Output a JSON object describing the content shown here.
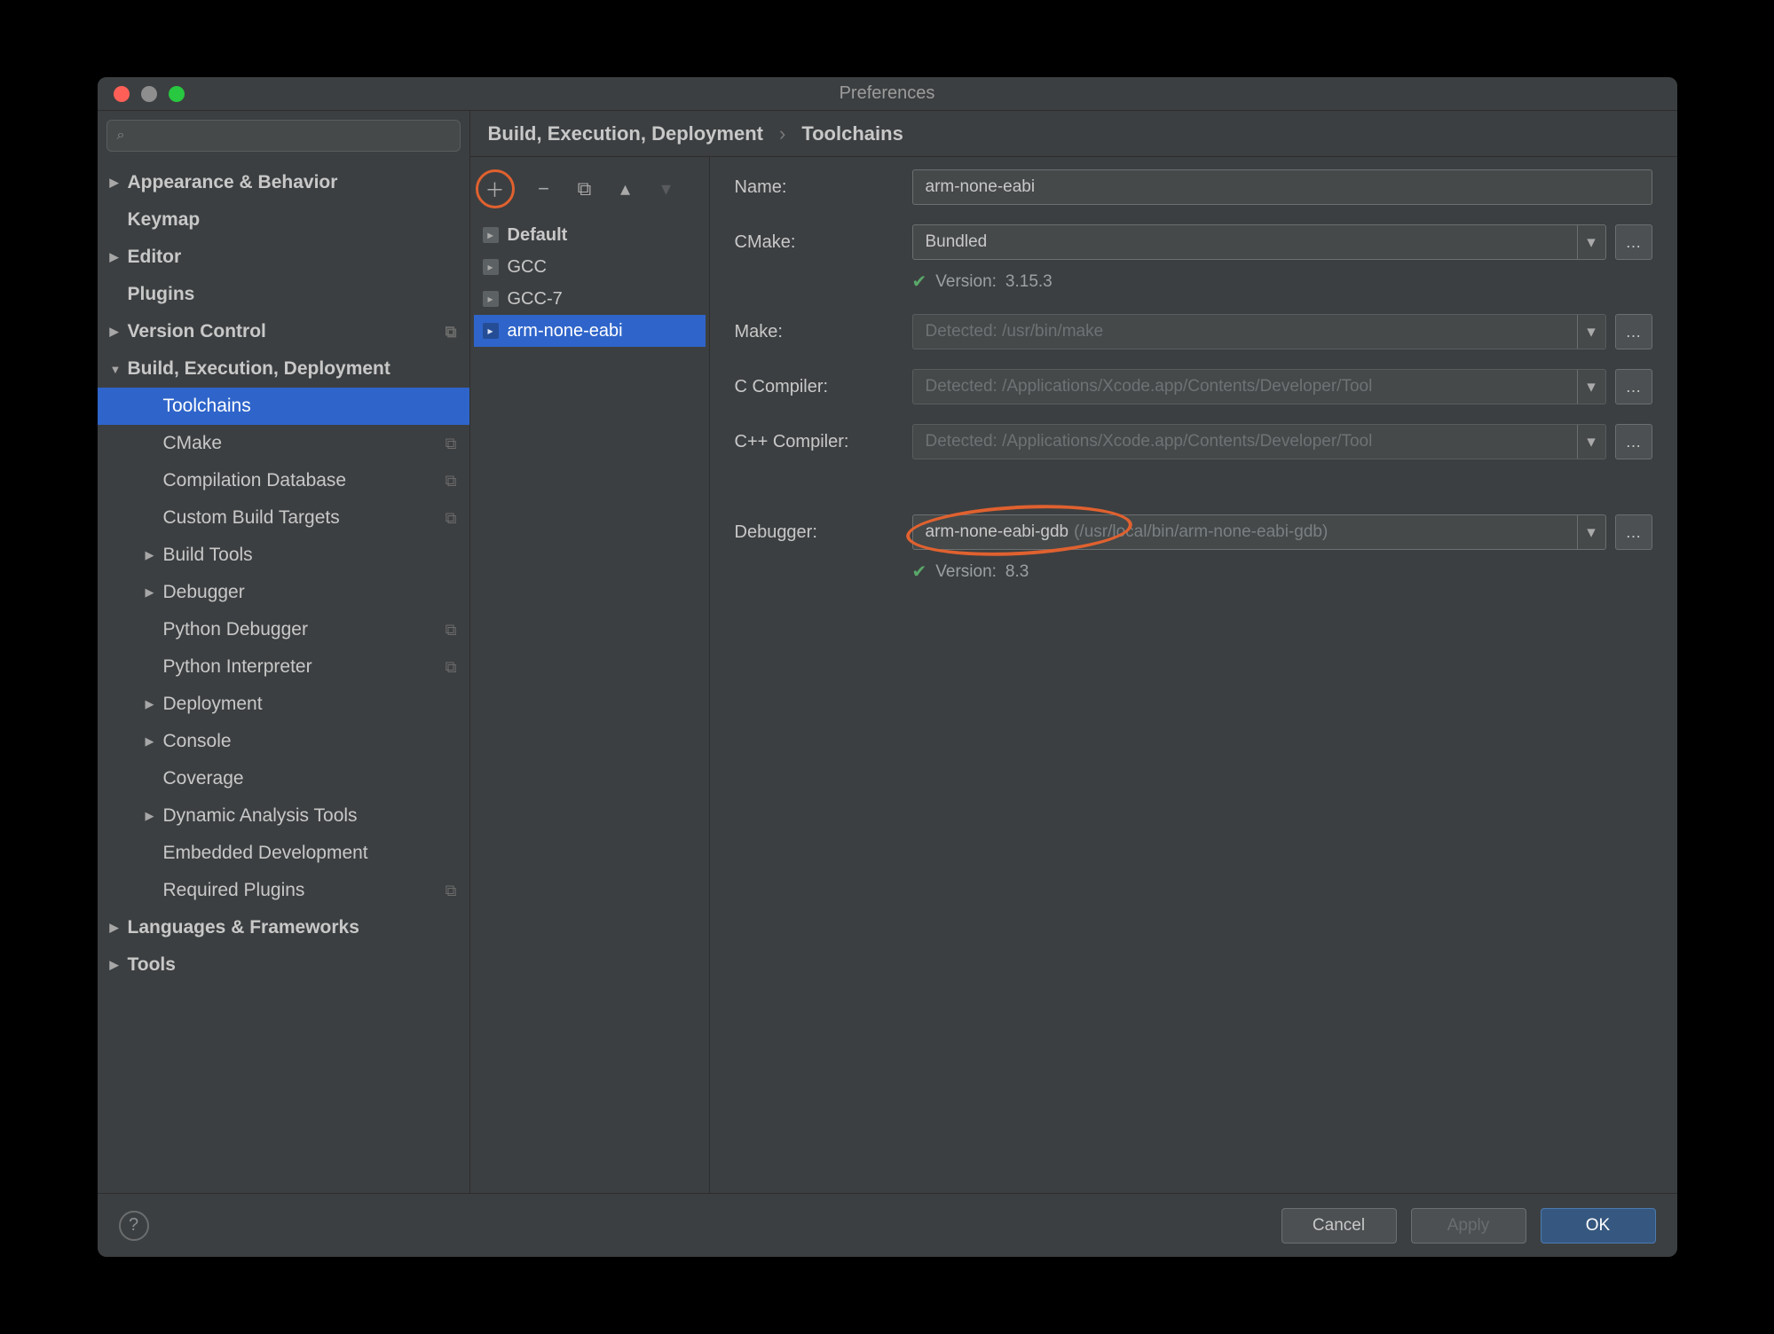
{
  "window_title": "Preferences",
  "breadcrumb": {
    "root": "Build, Execution, Deployment",
    "leaf": "Toolchains"
  },
  "sidebar": {
    "items": [
      {
        "label": "Appearance & Behavior",
        "arrow": true
      },
      {
        "label": "Keymap",
        "arrow": false
      },
      {
        "label": "Editor",
        "arrow": true
      },
      {
        "label": "Plugins",
        "arrow": false
      },
      {
        "label": "Version Control",
        "arrow": true,
        "badge": true
      },
      {
        "label": "Build, Execution, Deployment",
        "arrow": true,
        "expanded": true
      },
      {
        "label": "Toolchains",
        "child": true,
        "selected": true
      },
      {
        "label": "CMake",
        "child": true,
        "badge": true
      },
      {
        "label": "Compilation Database",
        "child": true,
        "badge": true
      },
      {
        "label": "Custom Build Targets",
        "child": true,
        "badge": true
      },
      {
        "label": "Build Tools",
        "child": true,
        "arrow": true
      },
      {
        "label": "Debugger",
        "child": true,
        "arrow": true
      },
      {
        "label": "Python Debugger",
        "child": true,
        "badge": true
      },
      {
        "label": "Python Interpreter",
        "child": true,
        "badge": true
      },
      {
        "label": "Deployment",
        "child": true,
        "arrow": true
      },
      {
        "label": "Console",
        "child": true,
        "arrow": true
      },
      {
        "label": "Coverage",
        "child": true
      },
      {
        "label": "Dynamic Analysis Tools",
        "child": true,
        "arrow": true
      },
      {
        "label": "Embedded Development",
        "child": true
      },
      {
        "label": "Required Plugins",
        "child": true,
        "badge": true
      },
      {
        "label": "Languages & Frameworks",
        "arrow": true
      },
      {
        "label": "Tools",
        "arrow": true
      }
    ]
  },
  "toolchains_list": [
    {
      "label": "Default",
      "bold": true
    },
    {
      "label": "GCC"
    },
    {
      "label": "GCC-7"
    },
    {
      "label": "arm-none-eabi",
      "selected": true
    }
  ],
  "form": {
    "name_label": "Name:",
    "name_value": "arm-none-eabi",
    "cmake_label": "CMake:",
    "cmake_value": "Bundled",
    "cmake_version_prefix": "Version:",
    "cmake_version": "3.15.3",
    "make_label": "Make:",
    "make_value": "Detected: /usr/bin/make",
    "ccomp_label": "C Compiler:",
    "ccomp_value": "Detected: /Applications/Xcode.app/Contents/Developer/Tool",
    "cpp_label": "C++ Compiler:",
    "cpp_value": "Detected: /Applications/Xcode.app/Contents/Developer/Tool",
    "debugger_label": "Debugger:",
    "debugger_value_name": "arm-none-eabi-gdb",
    "debugger_value_path": "(/usr/local/bin/arm-none-eabi-gdb)",
    "debugger_version_prefix": "Version:",
    "debugger_version": "8.3"
  },
  "footer": {
    "cancel": "Cancel",
    "apply": "Apply",
    "ok": "OK"
  }
}
